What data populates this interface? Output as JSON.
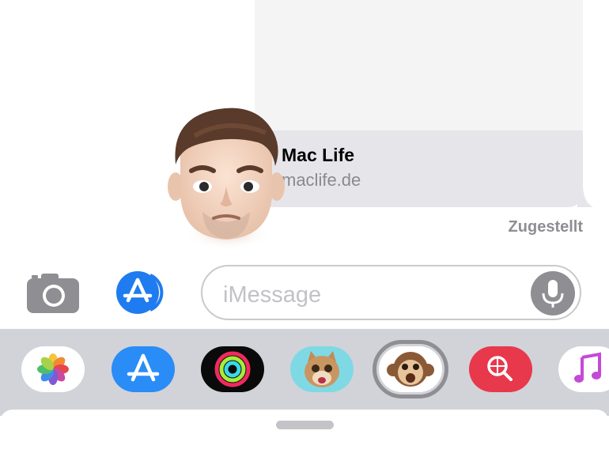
{
  "conversation": {
    "link_preview": {
      "title": "Mac Life",
      "domain": "maclife.de"
    },
    "delivery_status": "Zugestellt"
  },
  "composer": {
    "placeholder": "iMessage",
    "camera_icon": "camera-icon",
    "appstore_icon": "appstore-icon",
    "mic_icon": "microphone-icon"
  },
  "app_drawer": {
    "apps": [
      {
        "name": "photos",
        "icon": "photos-icon"
      },
      {
        "name": "app-store",
        "icon": "appstore-icon"
      },
      {
        "name": "activity",
        "icon": "activity-rings-icon"
      },
      {
        "name": "animoji-cat",
        "icon": "cat-animoji-icon"
      },
      {
        "name": "animoji-monkey",
        "icon": "monkey-animoji-icon",
        "selected": true
      },
      {
        "name": "image-search",
        "icon": "globe-search-icon"
      },
      {
        "name": "music",
        "icon": "music-note-icon"
      }
    ]
  },
  "colors": {
    "accent_blue": "#1f7bf0",
    "bubble_gray": "#e6e6ea",
    "drawer_gray": "#d1d3d9",
    "search_red": "#e8384c"
  }
}
